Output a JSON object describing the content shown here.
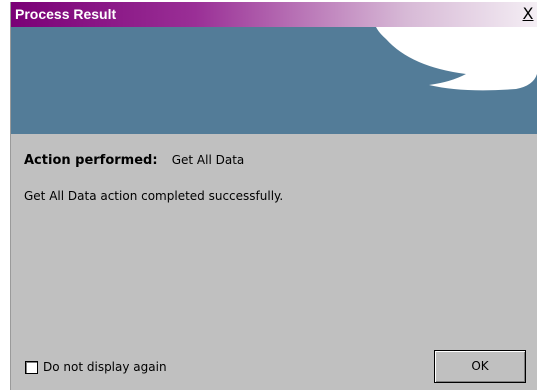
{
  "window": {
    "title": "Process Result",
    "close_glyph": "X"
  },
  "banner": {
    "background_color": "#537c98",
    "decoration": "white-speech-bubble"
  },
  "content": {
    "action_label": "Action performed:",
    "action_value": "Get All Data",
    "result_message": "Get All Data action completed successfully."
  },
  "footer": {
    "checkbox_label": "Do not display again",
    "checkbox_checked": false,
    "ok_label": "OK"
  },
  "colors": {
    "titlebar_start": "#7a0076",
    "titlebar_end": "#f4eef4",
    "dialog_background": "#c0c0c0"
  }
}
